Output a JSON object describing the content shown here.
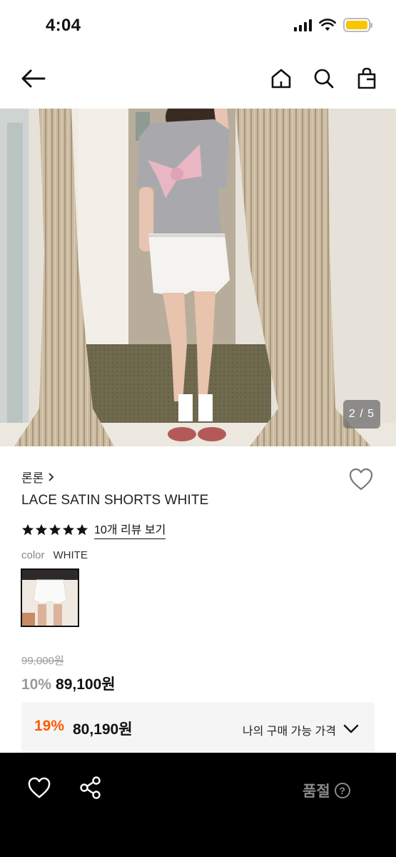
{
  "status_bar": {
    "time": "4:04"
  },
  "nav": {
    "icons": [
      "back-arrow-icon",
      "home-icon",
      "search-icon",
      "shopping-bag-icon"
    ]
  },
  "gallery": {
    "page_indicator": "2 / 5",
    "current_page": 2,
    "total_pages": 5
  },
  "product": {
    "brand": "론론",
    "name": "LACE SATIN SHORTS WHITE",
    "rating_stars": 5,
    "review_link": "10개 리뷰 보기",
    "color_label": "color",
    "color_value": "WHITE",
    "original_price": "99,000원",
    "discount_rate": "10%",
    "sale_price": "89,100원"
  },
  "benefit": {
    "rate": "19%",
    "price": "80,190원",
    "label": "나의 구매 가능 가격"
  },
  "bottom_bar": {
    "status": "품절",
    "help": "?"
  },
  "colors": {
    "accent_orange": "#ff5a00",
    "muted_gray": "#9a9a9a",
    "bottom_bar_bg": "#000000",
    "battery": "#f6c700"
  }
}
